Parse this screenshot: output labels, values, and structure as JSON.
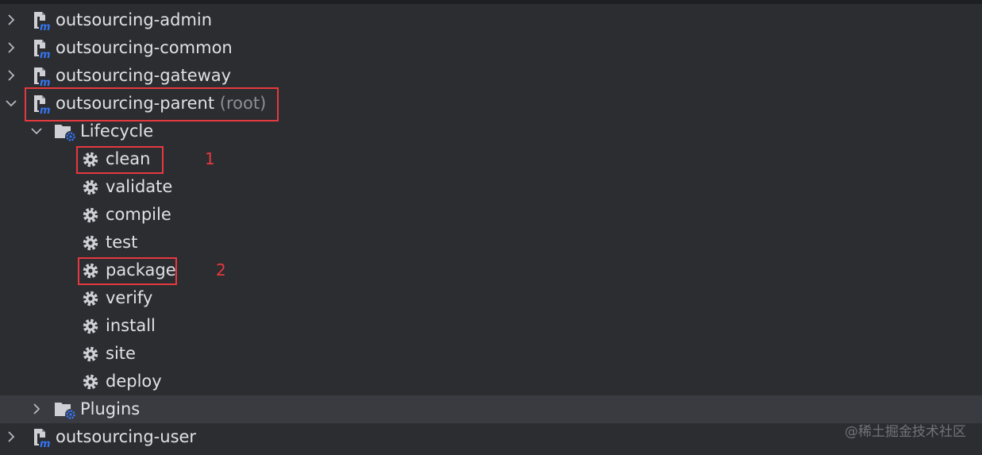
{
  "modules_top": [
    {
      "label": "outsourcing-admin"
    },
    {
      "label": "outsourcing-common"
    },
    {
      "label": "outsourcing-gateway"
    }
  ],
  "parent": {
    "label": "outsourcing-parent",
    "suffix": "(root)"
  },
  "lifecycle": {
    "label": "Lifecycle",
    "phases": [
      "clean",
      "validate",
      "compile",
      "test",
      "package",
      "verify",
      "install",
      "site",
      "deploy"
    ]
  },
  "plugins": {
    "label": "Plugins"
  },
  "modules_bottom": [
    {
      "label": "outsourcing-user"
    }
  ],
  "annotations": {
    "mark1": "1",
    "mark2": "2"
  },
  "watermark": "@稀土掘金技术社区",
  "colors": {
    "background": "#2b2d30",
    "selected_row": "#393b40",
    "highlight": "#e5393f",
    "maven_icon_blue": "#3574f0"
  }
}
